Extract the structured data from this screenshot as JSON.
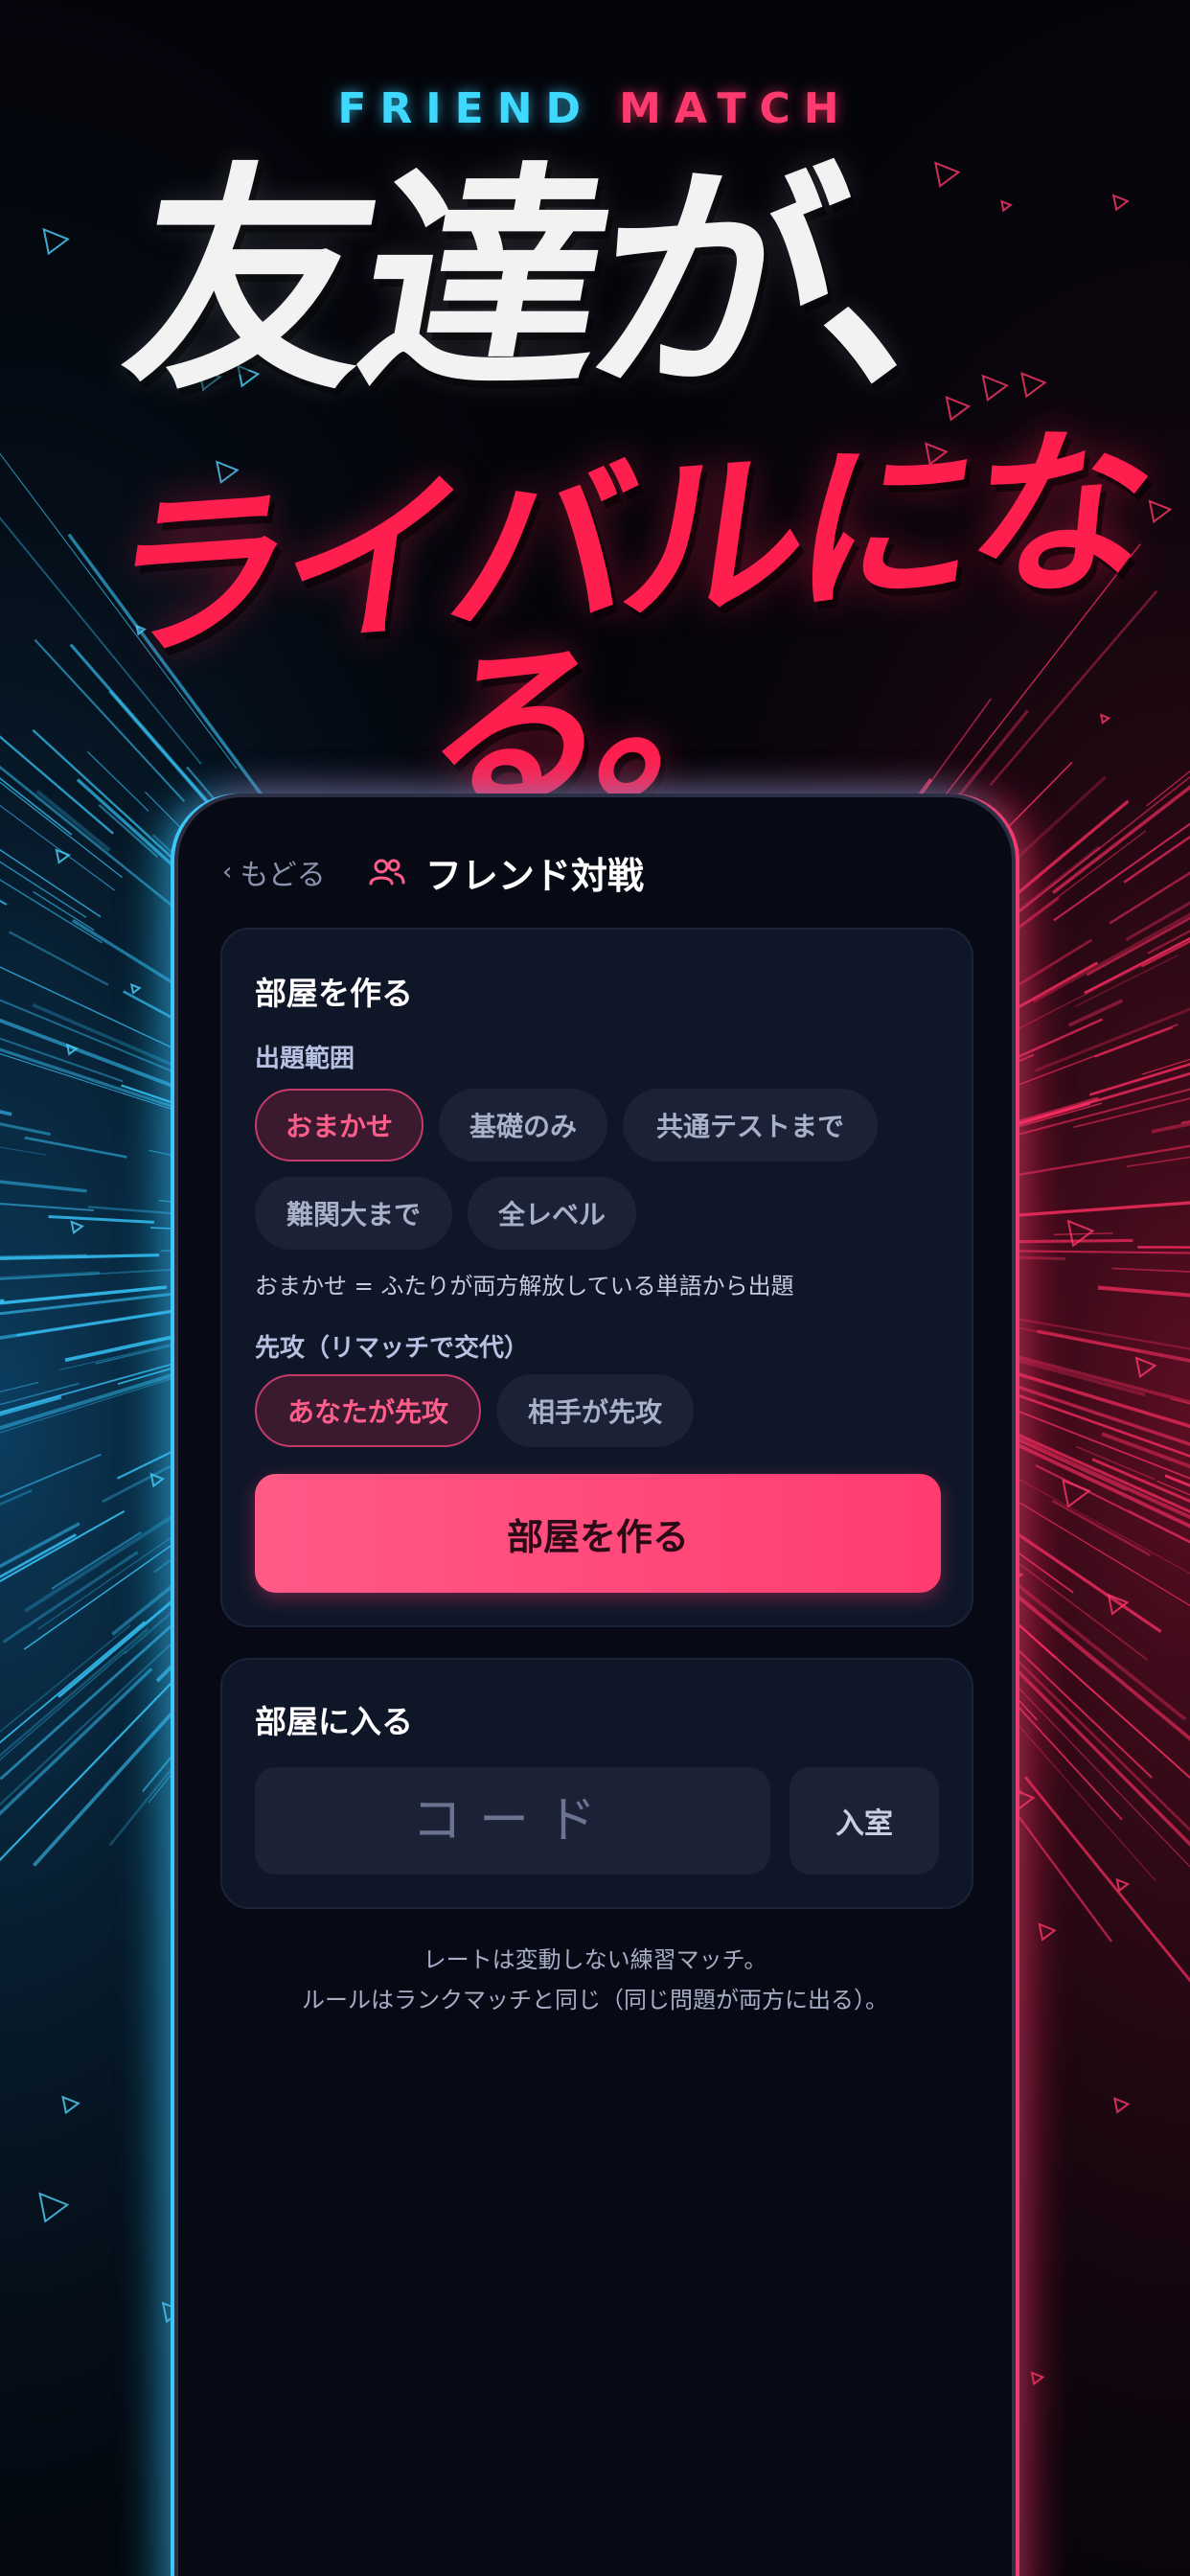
{
  "hero": {
    "eyebrow_1": "FRIEND",
    "eyebrow_2": "MATCH",
    "line1": "友達が、",
    "line2": "ライバルになる。"
  },
  "header": {
    "back_label": "もどる",
    "title": "フレンド対戦",
    "icon": "users-icon"
  },
  "create_room": {
    "title": "部屋を作る",
    "range_label": "出題範囲",
    "range_options": [
      "おまかせ",
      "基礎のみ",
      "共通テストまで",
      "難関大まで",
      "全レベル"
    ],
    "range_selected": "おまかせ",
    "range_note": "おまかせ = ふたりが両方解放している単語から出題",
    "turn_label": "先攻（リマッチで交代）",
    "turn_options": [
      "あなたが先攻",
      "相手が先攻"
    ],
    "turn_selected": "あなたが先攻",
    "button": "部屋を作る"
  },
  "join_room": {
    "title": "部屋に入る",
    "code_placeholder": "コード",
    "button": "入室"
  },
  "footer": {
    "line1": "レートは変動しない練習マッチ。",
    "line2": "ルールはランクマッチと同じ（同じ問題が両方に出る）。"
  },
  "colors": {
    "accent_pink": "#ff3c70",
    "accent_cyan": "#3fd9ff",
    "hero_red": "#ff1f4f",
    "card_bg": "#0f1628"
  }
}
